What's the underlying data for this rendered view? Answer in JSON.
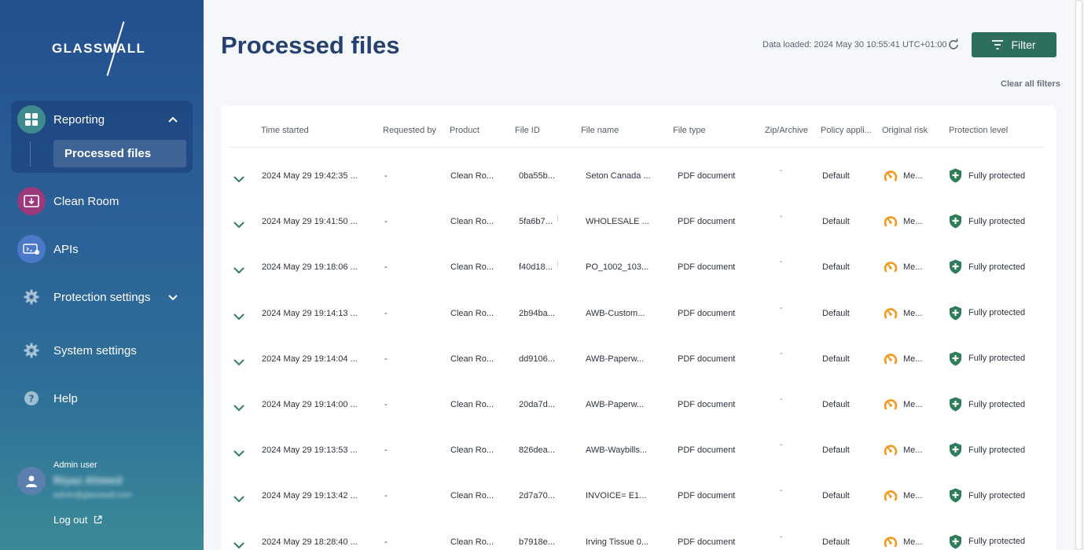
{
  "sidebar": {
    "logo_text": "GLASSWALL",
    "nav": {
      "reporting": "Reporting",
      "processed_files": "Processed files",
      "clean_room": "Clean Room",
      "apis": "APIs",
      "protection_settings": "Protection settings",
      "system_settings": "System settings",
      "help": "Help"
    },
    "user": {
      "role": "Admin user",
      "name": "Riyaz Ahmed",
      "email": "admin@glasswall.com"
    },
    "logout": "Log out"
  },
  "header": {
    "title": "Processed files",
    "data_loaded": "Data loaded: 2024 May 30 10:55:41 UTC+01:00",
    "filter_label": "Filter",
    "clear_filters": "Clear all filters"
  },
  "table": {
    "columns": [
      "Time started",
      "Requested by",
      "Product",
      "File ID",
      "File name",
      "File type",
      "Zip/Archive",
      "Policy appli...",
      "Original risk",
      "Protection level"
    ],
    "rows": [
      {
        "time": "2024 May 29 19:42:35 ...",
        "requested_by": "-",
        "product": "Clean Ro...",
        "file_id": "0ba55b...",
        "file_name": "Seton Canada ...",
        "file_type": "PDF document",
        "zip": "-",
        "policy": "Default",
        "risk": "Me...",
        "protection": "Fully protected"
      },
      {
        "time": "2024 May 29 19:41:50 ...",
        "requested_by": "-",
        "product": "Clean Ro...",
        "file_id": "5fa6b7...",
        "file_name": "WHOLESALE ...",
        "file_type": "PDF document",
        "zip": "-",
        "policy": "Default",
        "risk": "Me...",
        "protection": "Fully protected"
      },
      {
        "time": "2024 May 29 19:18:06 ...",
        "requested_by": "-",
        "product": "Clean Ro...",
        "file_id": "f40d18...",
        "file_name": "PO_1002_103...",
        "file_type": "PDF document",
        "zip": "-",
        "policy": "Default",
        "risk": "Me...",
        "protection": "Fully protected"
      },
      {
        "time": "2024 May 29 19:14:13 ...",
        "requested_by": "-",
        "product": "Clean Ro...",
        "file_id": "2b94ba...",
        "file_name": "AWB-Custom...",
        "file_type": "PDF document",
        "zip": "-",
        "policy": "Default",
        "risk": "Me...",
        "protection": "Fully protected"
      },
      {
        "time": "2024 May 29 19:14:04 ...",
        "requested_by": "-",
        "product": "Clean Ro...",
        "file_id": "dd9106...",
        "file_name": "AWB-Paperw...",
        "file_type": "PDF document",
        "zip": "-",
        "policy": "Default",
        "risk": "Me...",
        "protection": "Fully protected"
      },
      {
        "time": "2024 May 29 19:14:00 ...",
        "requested_by": "-",
        "product": "Clean Ro...",
        "file_id": "20da7d...",
        "file_name": "AWB-Paperw...",
        "file_type": "PDF document",
        "zip": "-",
        "policy": "Default",
        "risk": "Me...",
        "protection": "Fully protected"
      },
      {
        "time": "2024 May 29 19:13:53 ...",
        "requested_by": "-",
        "product": "Clean Ro...",
        "file_id": "826dea...",
        "file_name": "AWB-Waybills...",
        "file_type": "PDF document",
        "zip": "-",
        "policy": "Default",
        "risk": "Me...",
        "protection": "Fully protected"
      },
      {
        "time": "2024 May 29 19:13:42 ...",
        "requested_by": "-",
        "product": "Clean Ro...",
        "file_id": "2d7a70...",
        "file_name": "INVOICE= E1...",
        "file_type": "PDF document",
        "zip": "-",
        "policy": "Default",
        "risk": "Me...",
        "protection": "Fully protected"
      },
      {
        "time": "2024 May 29 18:28:40 ...",
        "requested_by": "-",
        "product": "Clean Ro...",
        "file_id": "b7918e...",
        "file_name": "Irving Tissue 0...",
        "file_type": "PDF document",
        "zip": "-",
        "policy": "Default",
        "risk": "Me...",
        "protection": "Fully protected"
      }
    ]
  },
  "colors": {
    "accent_green": "#2e6e5c",
    "title_blue": "#26406f",
    "risk_orange": "#f39a1e",
    "shield_green": "#2e7d5b"
  }
}
